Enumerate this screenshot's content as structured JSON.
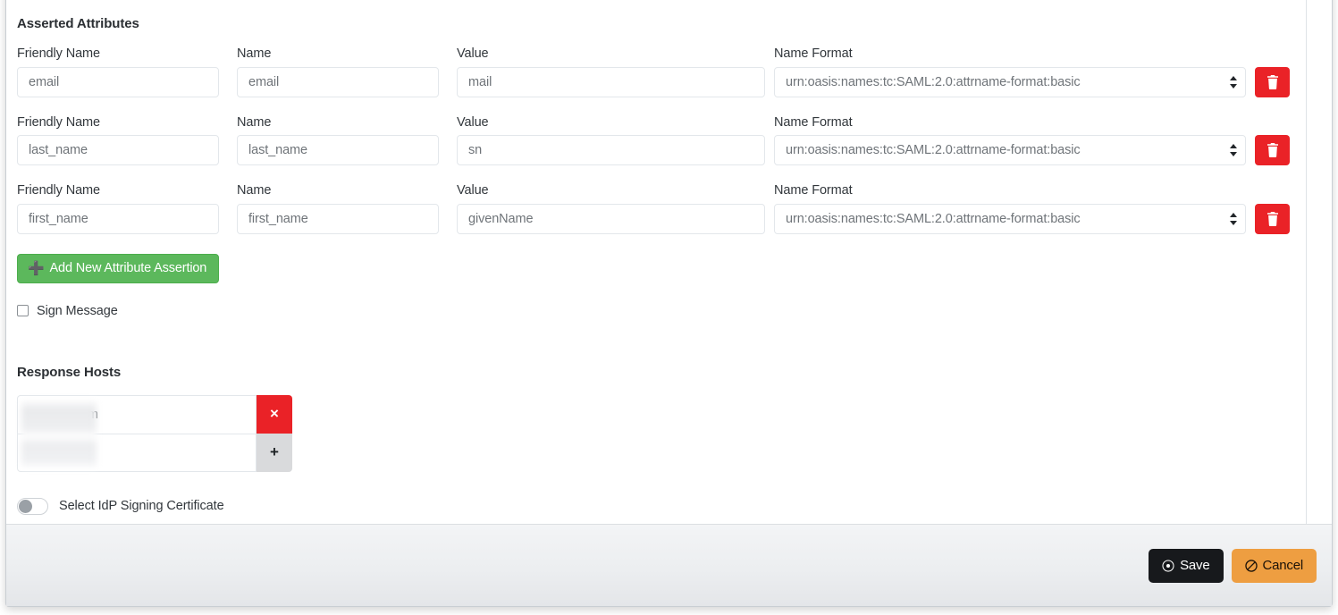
{
  "sections": {
    "asserted_attributes": {
      "title": "Asserted Attributes",
      "column_labels": {
        "friendly_name": "Friendly Name",
        "name": "Name",
        "value": "Value",
        "name_format": "Name Format"
      },
      "rows": [
        {
          "friendly_name": "email",
          "name": "email",
          "value": "mail",
          "name_format": "urn:oasis:names:tc:SAML:2.0:attrname-format:basic",
          "delete_icon": "trash-icon"
        },
        {
          "friendly_name": "last_name",
          "name": "last_name",
          "value": "sn",
          "name_format": "urn:oasis:names:tc:SAML:2.0:attrname-format:basic",
          "delete_icon": "trash-icon"
        },
        {
          "friendly_name": "first_name",
          "name": "first_name",
          "value": "givenName",
          "name_format": "urn:oasis:names:tc:SAML:2.0:attrname-format:basic",
          "delete_icon": "trash-icon"
        }
      ],
      "add_button": {
        "label": "Add New Attribute Assertion",
        "icon": "plus-icon",
        "color": "#5cb85c"
      },
      "sign_message": {
        "label": "Sign Message",
        "checked": false
      }
    },
    "response_hosts": {
      "title": "Response Hosts",
      "rows": [
        {
          "value": "etsonar.com",
          "redacted": true,
          "action_label": "×",
          "action_icon": "remove-host-icon",
          "action_color": "#ea2227"
        },
        {
          "value": "ost",
          "redacted": true,
          "action_label": "+",
          "action_icon": "add-host-icon",
          "action_color": "#d9dadc"
        }
      ]
    },
    "idp_certificate": {
      "label": "Select IdP Signing Certificate",
      "enabled": false
    }
  },
  "footer": {
    "save": {
      "label": "Save",
      "icon": "circle-dot-icon",
      "color": "#17191c"
    },
    "cancel": {
      "label": "Cancel",
      "icon": "ban-icon",
      "color": "#ee9e41"
    }
  }
}
